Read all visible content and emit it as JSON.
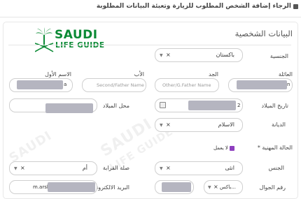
{
  "header": {
    "title": "الرجاء إضافة الشخص المطلوب للزيارة وتعبئة البيانات المطلوبة"
  },
  "section": {
    "title": "البيانات الشخصية"
  },
  "logo": {
    "line1": "SAUDI",
    "line2": "LIFE GUIDE"
  },
  "watermark": {
    "line1": "SAUDI",
    "line2": "LIFE GUIDE"
  },
  "fields": {
    "nationality": {
      "label": "الجنسية",
      "value": "باكستان"
    },
    "family_name": {
      "label": "العائلة",
      "value_suffix": "n"
    },
    "grandfather": {
      "label": "الجد",
      "placeholder": "Other/G.Father Name"
    },
    "father": {
      "label": "الأب",
      "placeholder": "Second/Father Name"
    },
    "first_name": {
      "label": "الاسم الأول",
      "value_suffix": "a"
    },
    "birth_date": {
      "label": "تاريخ الميلاد",
      "value_prefix": "2"
    },
    "birth_place": {
      "label": "محل الميلاد"
    },
    "religion": {
      "label": "الديانة",
      "value": "الاسلام"
    },
    "employment_status": {
      "label": "الحالة المهنية *",
      "checkbox_label": "لا يعمل"
    },
    "gender": {
      "label": "الجنس",
      "value": "انثى"
    },
    "relationship": {
      "label": "صلة القرابة",
      "value": "أم"
    },
    "mobile": {
      "label": "رقم الجوال",
      "code_value": "باكس..."
    },
    "email": {
      "label": "البريد الالكتروني",
      "value_prefix": "m.arslan"
    }
  },
  "colors": {
    "logo_green": "#0b8a35",
    "checkbox_purple": "#8e3fbf",
    "redaction": "#b5b5c0"
  },
  "icons": {
    "header": "list-icon",
    "clear": "x-icon",
    "dropdown": "chevron-down-icon",
    "calendar": "calendar-icon"
  }
}
